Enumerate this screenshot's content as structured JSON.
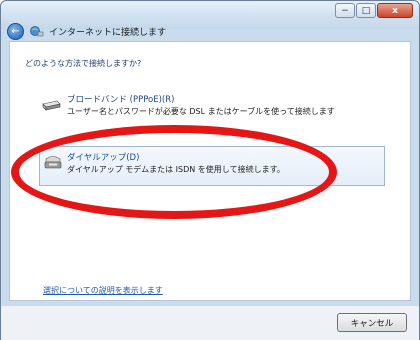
{
  "window": {
    "title": "インターネットに接続します",
    "controls": {
      "minimize": "−",
      "maximize": "□",
      "close": "x"
    },
    "back_glyph": "←"
  },
  "page": {
    "question": "どのような方法で接続しますか?"
  },
  "options": [
    {
      "icon": "broadband-modem-icon",
      "title": "ブロードバンド (PPPoE)(R)",
      "description": "ユーザー名とパスワードが必要な DSL またはケーブルを使って接続します"
    },
    {
      "icon": "dialup-modem-icon",
      "title": "ダイヤルアップ(D)",
      "description": "ダイヤルアップ モデムまたは ISDN を使用して接続します。",
      "highlighted": true
    }
  ],
  "help_link": "選択についての説明を表示します",
  "footer": {
    "cancel_label": "キャンセル"
  },
  "colors": {
    "annotation_ellipse": "#e51616",
    "link": "#1f5aa8",
    "accent_title": "#1e4a8a"
  }
}
